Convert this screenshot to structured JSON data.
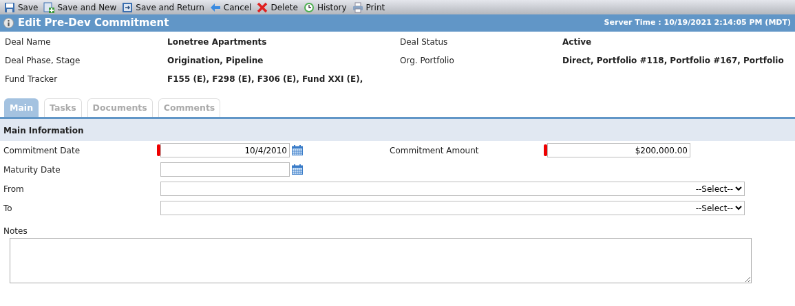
{
  "toolbar": [
    {
      "kind": "save",
      "label": "Save"
    },
    {
      "kind": "save-new",
      "label": "Save and New"
    },
    {
      "kind": "save-return",
      "label": "Save and Return"
    },
    {
      "kind": "cancel",
      "label": "Cancel"
    },
    {
      "kind": "delete",
      "label": "Delete"
    },
    {
      "kind": "history",
      "label": "History"
    },
    {
      "kind": "print",
      "label": "Print"
    }
  ],
  "header": {
    "title": "Edit Pre-Dev Commitment",
    "server_time": "Server Time : 10/19/2021 2:14:05 PM (MDT)"
  },
  "summary": [
    {
      "label": "Deal Name",
      "value": "Lonetree Apartments",
      "label_2": "Deal Status",
      "value_2": "Active"
    },
    {
      "label": "Deal Phase, Stage",
      "value": "Origination, Pipeline",
      "label_2": "Org. Portfolio",
      "value_2": "Direct, Portfolio #118, Portfolio #167, Portfolio"
    },
    {
      "label": "Fund Tracker",
      "value": "F155 (E), F298 (E), F306 (E), Fund XXI (E),"
    }
  ],
  "tabs": [
    {
      "label": "Main",
      "selected": true
    },
    {
      "label": "Tasks",
      "selected": false
    },
    {
      "label": "Documents",
      "selected": false
    },
    {
      "label": "Comments",
      "selected": false
    }
  ],
  "section": {
    "title": "Main Information"
  },
  "form_rows": [
    {
      "fields": [
        {
          "label": "Commitment Date",
          "kind": "date",
          "required": true,
          "value": "10/4/2010"
        },
        {
          "label": "Commitment Amount",
          "kind": "money",
          "required": true,
          "value": "$200,000.00"
        }
      ]
    },
    {
      "fields": [
        {
          "label": "Maturity Date",
          "kind": "date",
          "required": false
        }
      ]
    },
    {
      "fields": [
        {
          "label": "From",
          "kind": "select",
          "required": false,
          "value": "--Select--"
        }
      ]
    },
    {
      "fields": [
        {
          "label": "To",
          "kind": "select",
          "required": false,
          "value": "--Select--"
        }
      ]
    }
  ],
  "notes": {
    "label": "Notes"
  }
}
